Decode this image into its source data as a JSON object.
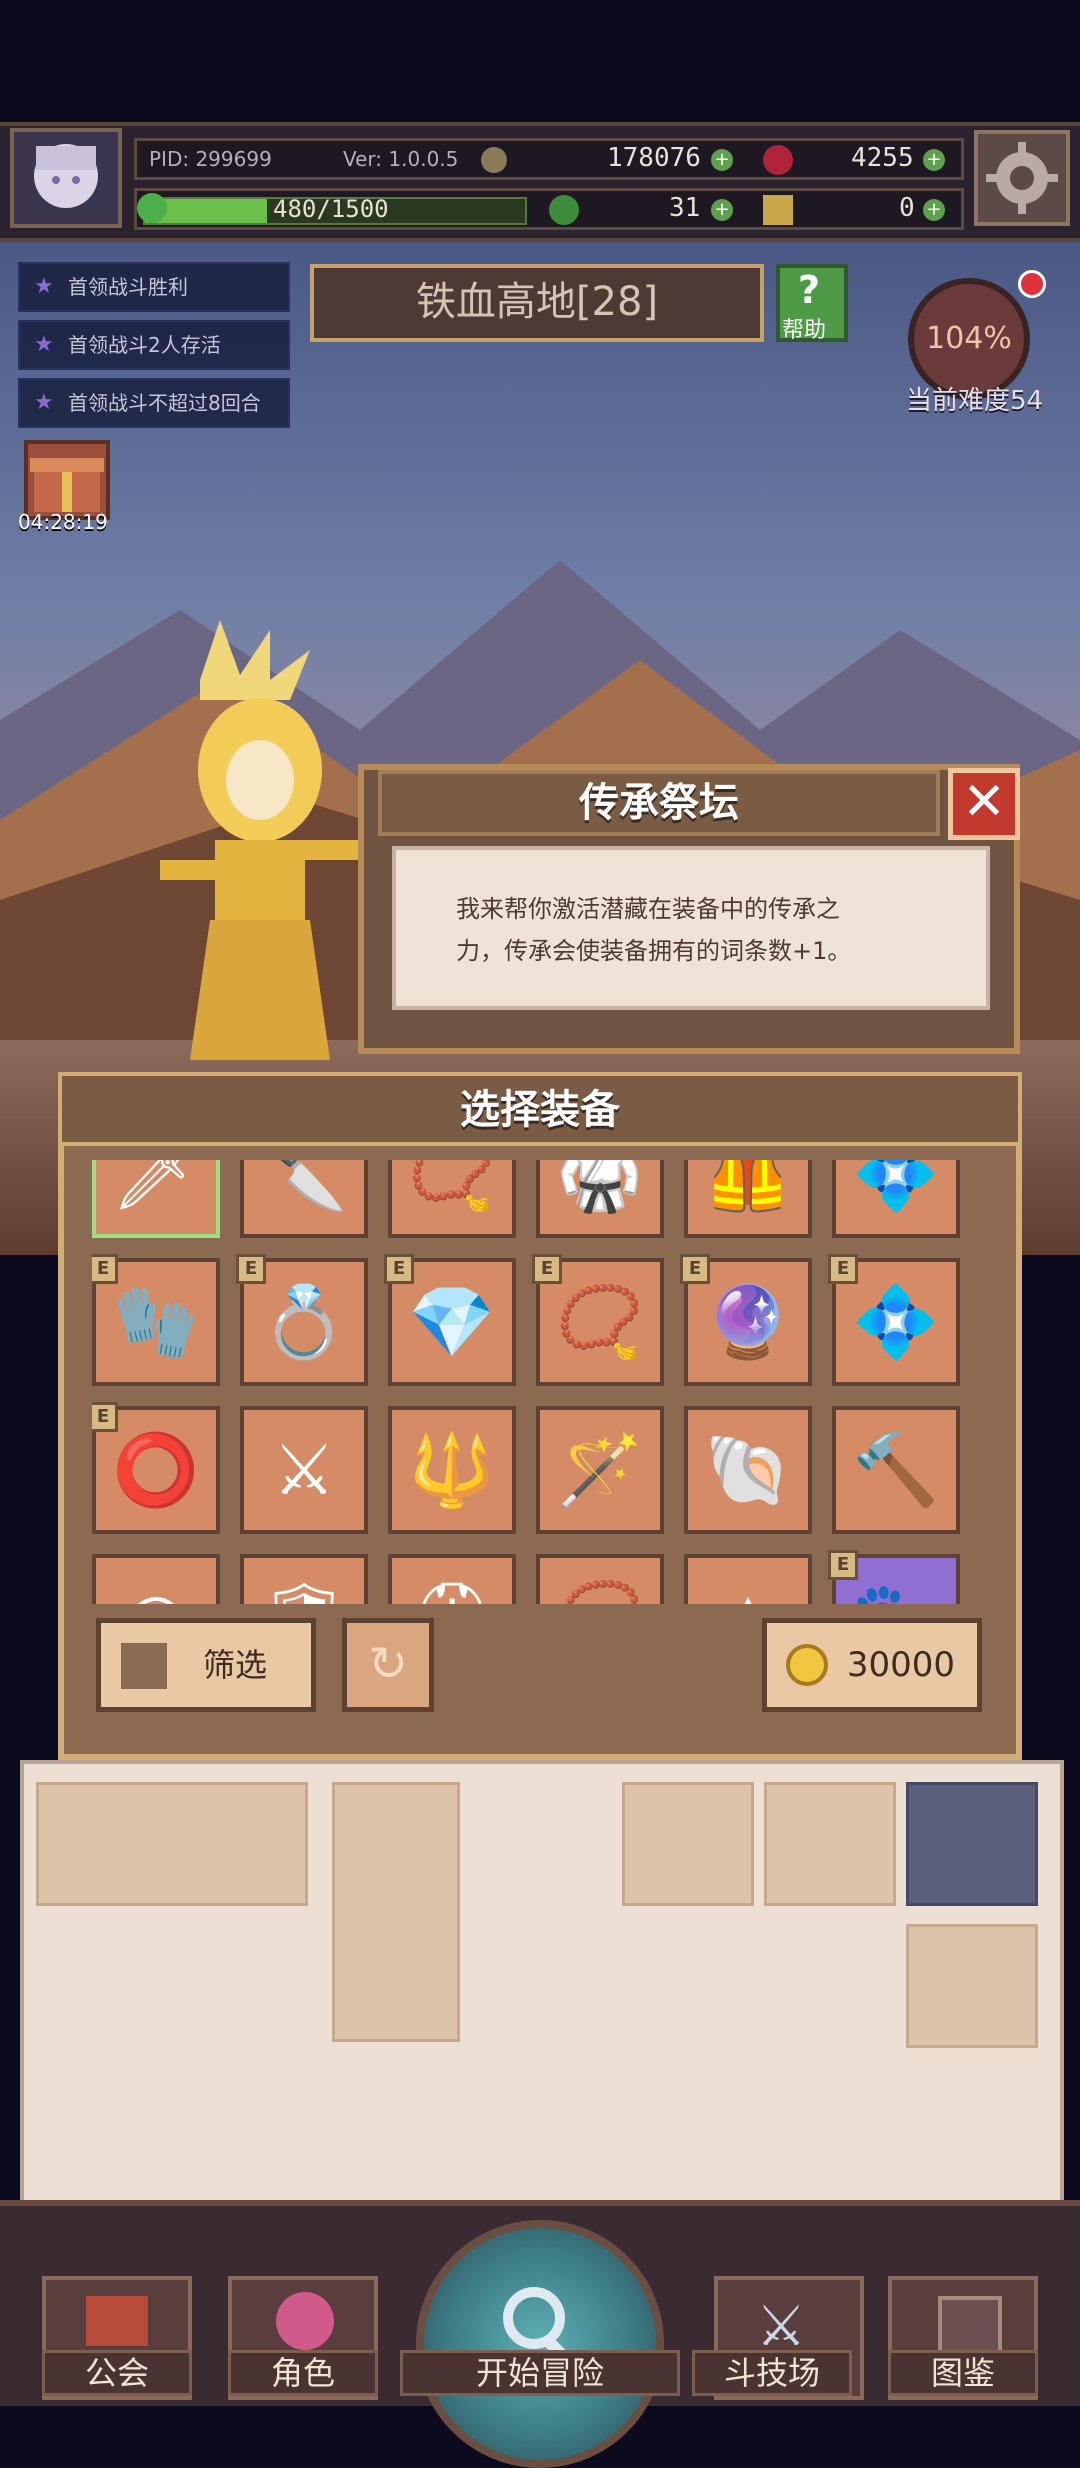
{
  "header": {
    "pid": "PID: 299699",
    "version": "Ver: 1.0.0.5",
    "gold": "178076",
    "gems": "4255",
    "stamina": "480/1500",
    "clover": "31",
    "keys": "0"
  },
  "quests": [
    {
      "label": "首领战斗胜利"
    },
    {
      "label": "首领战斗2人存活"
    },
    {
      "label": "首领战斗不超过8回合"
    }
  ],
  "stage": {
    "title": "铁血高地[28]",
    "help_label": "帮助",
    "difficulty_percent": "104%",
    "difficulty_label": "当前难度54"
  },
  "gift_timer": "04:28:19",
  "dialog": {
    "title": "传承祭坛",
    "close_icon": "close-icon",
    "text_line1": "我来帮你激活潜藏在装备中的传承之",
    "text_line2": "力，传承会使装备拥有的词条数+1。"
  },
  "equip_panel": {
    "title": "选择装备",
    "badge": "E",
    "filter_label": "筛选",
    "refresh_icon": "refresh-icon",
    "cost": "30000",
    "items": [
      {
        "icon": "sword-icon",
        "badge": false,
        "selected": true,
        "glyph": "🗡"
      },
      {
        "icon": "dagger-icon",
        "badge": false,
        "glyph": "🔪"
      },
      {
        "icon": "necklace-icon",
        "badge": false,
        "glyph": "📿"
      },
      {
        "icon": "armor-icon",
        "badge": false,
        "glyph": "🥋"
      },
      {
        "icon": "armor-icon",
        "badge": false,
        "glyph": "🦺"
      },
      {
        "icon": "necklace-icon",
        "badge": false,
        "glyph": "💠"
      },
      {
        "icon": "glove-icon",
        "badge": true,
        "glyph": "🧤"
      },
      {
        "icon": "ring-icon",
        "badge": true,
        "glyph": "💍"
      },
      {
        "icon": "crystal-icon",
        "badge": true,
        "glyph": "💎"
      },
      {
        "icon": "necklace-icon",
        "badge": true,
        "glyph": "📿"
      },
      {
        "icon": "amulet-icon",
        "badge": true,
        "glyph": "🔮"
      },
      {
        "icon": "pendant-icon",
        "badge": true,
        "glyph": "💠"
      },
      {
        "icon": "bracelet-icon",
        "badge": true,
        "glyph": "⭕"
      },
      {
        "icon": "sword-icon",
        "badge": false,
        "glyph": "⚔"
      },
      {
        "icon": "staff-icon",
        "badge": false,
        "glyph": "🔱"
      },
      {
        "icon": "wand-icon",
        "badge": false,
        "glyph": "🪄"
      },
      {
        "icon": "shell-icon",
        "badge": false,
        "glyph": "🐚"
      },
      {
        "icon": "hammer-icon",
        "badge": false,
        "glyph": "🔨"
      },
      {
        "icon": "belt-icon",
        "badge": false,
        "glyph": "◎"
      },
      {
        "icon": "shield-icon",
        "badge": false,
        "glyph": "🛡"
      },
      {
        "icon": "helmet-icon",
        "badge": false,
        "glyph": "⛑"
      },
      {
        "icon": "necklace-icon",
        "badge": false,
        "glyph": "📿"
      },
      {
        "icon": "arrow-icon",
        "badge": false,
        "glyph": "▲"
      },
      {
        "icon": "creature-icon",
        "badge": true,
        "glyph": "🐾",
        "rare": true
      }
    ]
  },
  "nav": {
    "guild": "公会",
    "character": "角色",
    "start": "开始冒险",
    "arena": "斗技场",
    "codex": "图鉴"
  }
}
